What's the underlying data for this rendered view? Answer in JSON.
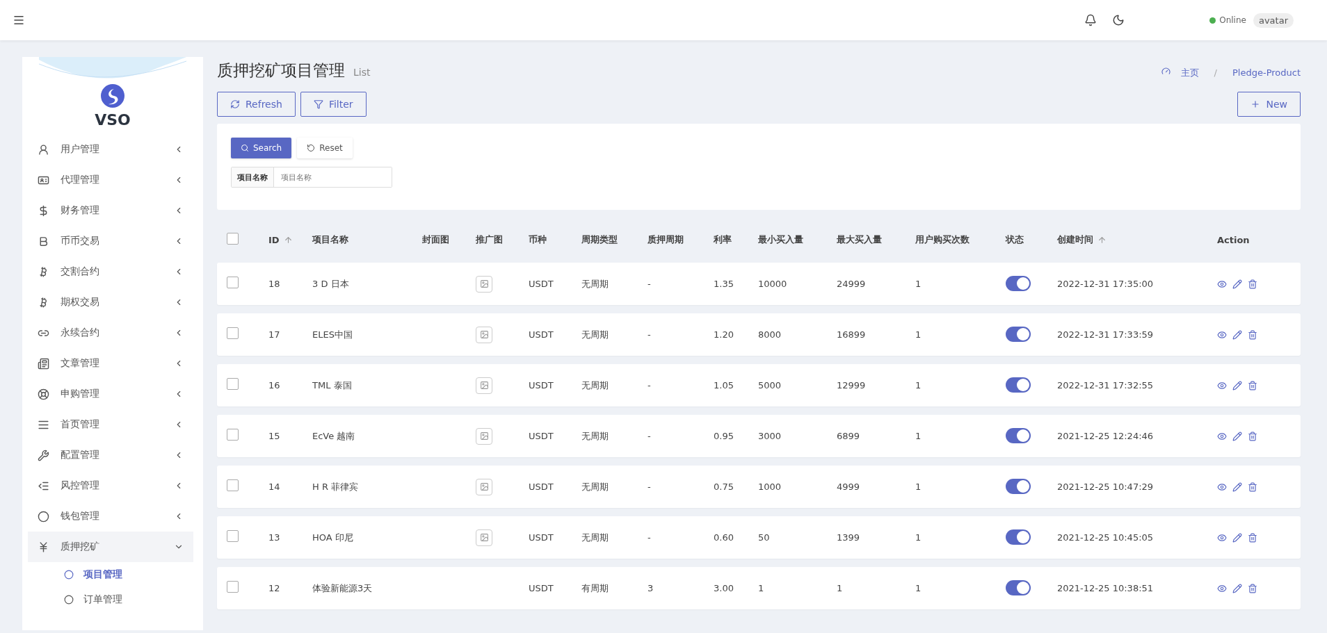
{
  "topbar": {
    "status": "Online",
    "avatar_alt": "avatar"
  },
  "sidebar": {
    "brand": "VSO",
    "items": [
      {
        "label": "用户管理",
        "expanded": false
      },
      {
        "label": "代理管理",
        "expanded": false
      },
      {
        "label": "财务管理",
        "expanded": false
      },
      {
        "label": "币币交易",
        "expanded": false
      },
      {
        "label": "交割合约",
        "expanded": false
      },
      {
        "label": "期权交易",
        "expanded": false
      },
      {
        "label": "永续合约",
        "expanded": false
      },
      {
        "label": "文章管理",
        "expanded": false
      },
      {
        "label": "申购管理",
        "expanded": false
      },
      {
        "label": "首页管理",
        "expanded": false
      },
      {
        "label": "配置管理",
        "expanded": false
      },
      {
        "label": "风控管理",
        "expanded": false
      },
      {
        "label": "钱包管理",
        "expanded": false
      },
      {
        "label": "质押挖矿",
        "expanded": true,
        "children": [
          {
            "label": "项目管理",
            "selected": true
          },
          {
            "label": "订单管理",
            "selected": false
          }
        ]
      }
    ]
  },
  "header": {
    "title": "质押挖矿项目管理",
    "subtitle": "List",
    "breadcrumb": [
      "主页",
      "Pledge-Product"
    ],
    "breadcrumb_separator": "/"
  },
  "toolbar": {
    "buttons": [
      "Refresh",
      "Filter"
    ],
    "new_button": "New"
  },
  "search": {
    "search_button": "Search",
    "reset_button": "Reset",
    "field_label": "项目名称",
    "placeholder": "项目名称"
  },
  "table": {
    "all_checked": false,
    "columns": [
      {
        "label": "ID",
        "sortable": true
      },
      {
        "label": "项目名称",
        "sortable": false
      },
      {
        "label": "封面图",
        "sortable": false
      },
      {
        "label": "推广图",
        "sortable": false
      },
      {
        "label": "币种",
        "sortable": false
      },
      {
        "label": "周期类型",
        "sortable": false
      },
      {
        "label": "质押周期",
        "sortable": false
      },
      {
        "label": "利率",
        "sortable": false
      },
      {
        "label": "最小买入量",
        "sortable": false
      },
      {
        "label": "最大买入量",
        "sortable": false
      },
      {
        "label": "用户购买次数",
        "sortable": false
      },
      {
        "label": "状态",
        "sortable": false
      },
      {
        "label": "创建时间",
        "sortable": true
      },
      {
        "label": "Action",
        "sortable": false
      }
    ],
    "rows": [
      {
        "id": "18",
        "name": "3 D 日本",
        "promo_image": true,
        "coin": "USDT",
        "cycle_type": "无周期",
        "period": "-",
        "rate": "1.35",
        "min": "10000",
        "max": "24999",
        "count": "1",
        "on": true,
        "created": "2022-12-31 17:35:00",
        "checked": false
      },
      {
        "id": "17",
        "name": "ELES中国",
        "promo_image": true,
        "coin": "USDT",
        "cycle_type": "无周期",
        "period": "-",
        "rate": "1.20",
        "min": "8000",
        "max": "16899",
        "count": "1",
        "on": true,
        "created": "2022-12-31 17:33:59",
        "checked": false
      },
      {
        "id": "16",
        "name": "TML 泰国",
        "promo_image": true,
        "coin": "USDT",
        "cycle_type": "无周期",
        "period": "-",
        "rate": "1.05",
        "min": "5000",
        "max": "12999",
        "count": "1",
        "on": true,
        "created": "2022-12-31 17:32:55",
        "checked": false
      },
      {
        "id": "15",
        "name": "EcVe 越南",
        "promo_image": true,
        "coin": "USDT",
        "cycle_type": "无周期",
        "period": "-",
        "rate": "0.95",
        "min": "3000",
        "max": "6899",
        "count": "1",
        "on": true,
        "created": "2021-12-25 12:24:46",
        "checked": false
      },
      {
        "id": "14",
        "name": "H R 菲律宾",
        "promo_image": true,
        "coin": "USDT",
        "cycle_type": "无周期",
        "period": "-",
        "rate": "0.75",
        "min": "1000",
        "max": "4999",
        "count": "1",
        "on": true,
        "created": "2021-12-25 10:47:29",
        "checked": false
      },
      {
        "id": "13",
        "name": "HOA 印尼",
        "promo_image": true,
        "coin": "USDT",
        "cycle_type": "无周期",
        "period": "-",
        "rate": "0.60",
        "min": "50",
        "max": "1399",
        "count": "1",
        "on": true,
        "created": "2021-12-25 10:45:05",
        "checked": false
      },
      {
        "id": "12",
        "name": "体验新能源3天",
        "promo_image": false,
        "coin": "USDT",
        "cycle_type": "有周期",
        "period": "3",
        "rate": "3.00",
        "min": "1",
        "max": "1",
        "count": "1",
        "on": true,
        "created": "2021-12-25 10:38:51",
        "checked": false
      }
    ]
  }
}
